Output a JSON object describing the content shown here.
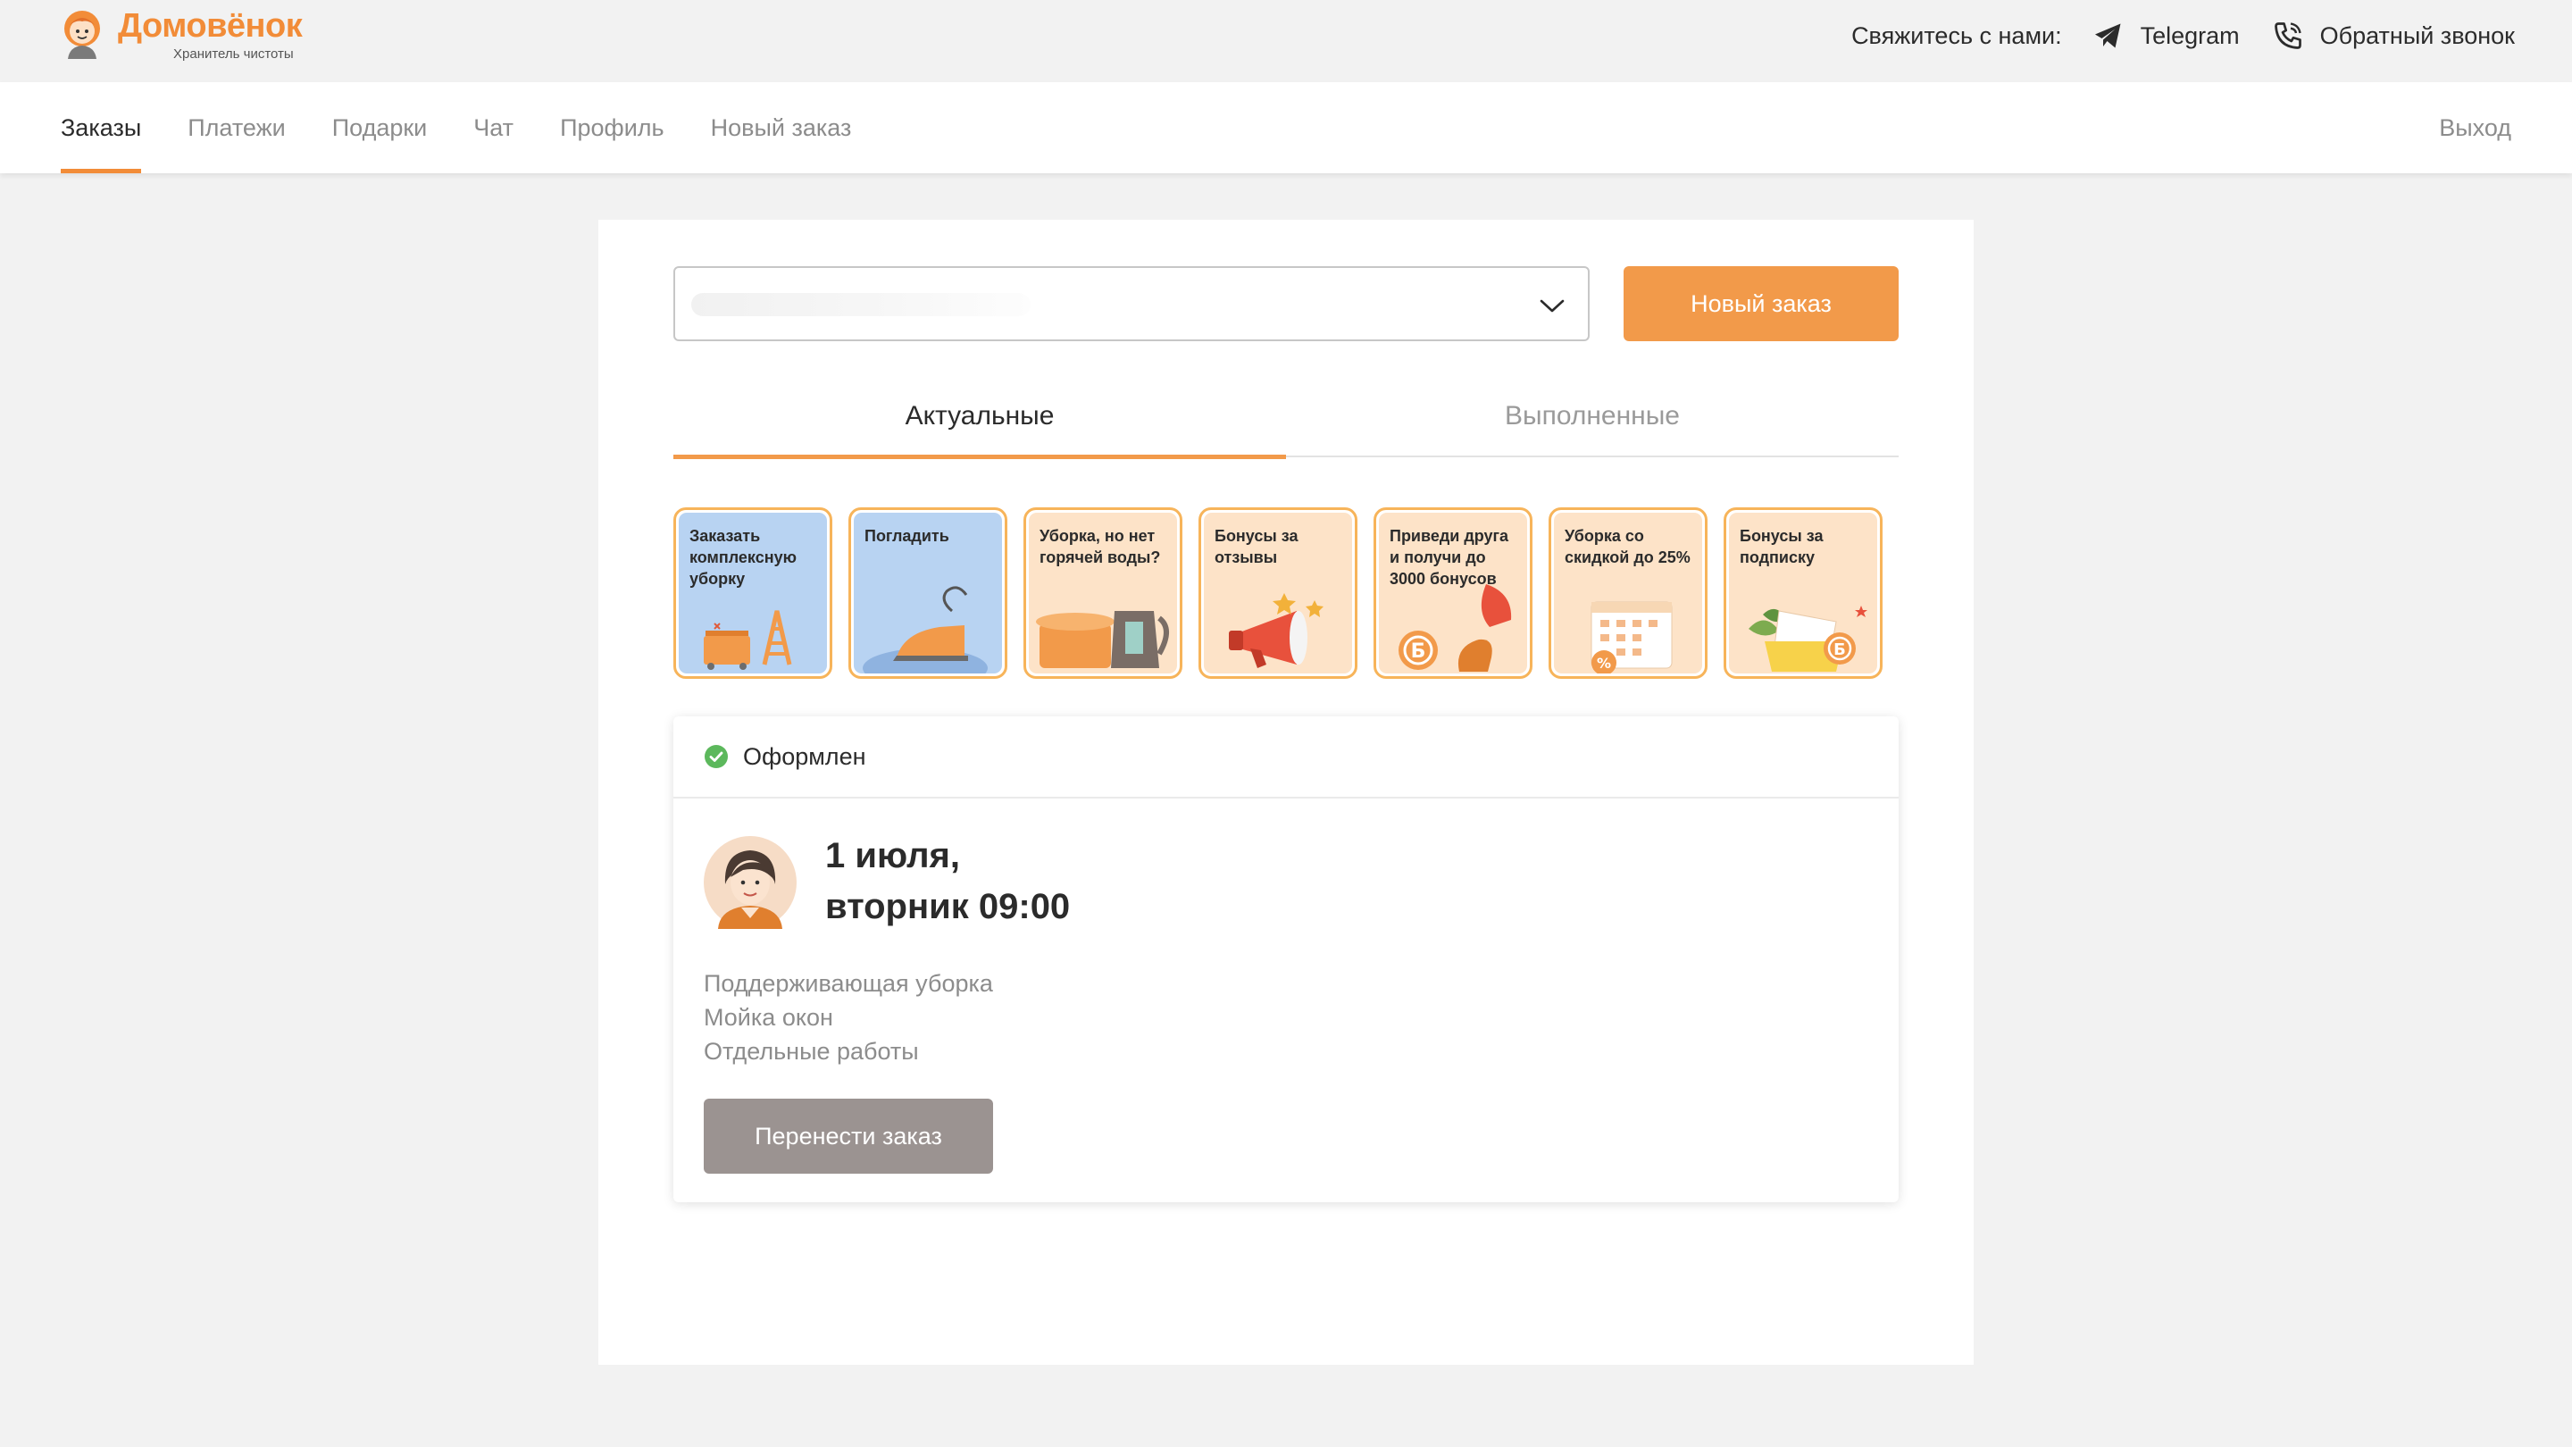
{
  "brand": {
    "name": "Домовёнок",
    "tagline": "Хранитель чистоты",
    "accent_color": "#f28c38"
  },
  "contacts": {
    "label": "Свяжитесь с нами:",
    "telegram": {
      "icon": "telegram-icon",
      "label": "Telegram"
    },
    "callback": {
      "icon": "phone-icon",
      "label": "Обратный звонок"
    }
  },
  "nav": {
    "tabs": [
      {
        "label": "Заказы",
        "active": true
      },
      {
        "label": "Платежи",
        "active": false
      },
      {
        "label": "Подарки",
        "active": false
      },
      {
        "label": "Чат",
        "active": false
      },
      {
        "label": "Профиль",
        "active": false
      },
      {
        "label": "Новый заказ",
        "active": false
      }
    ],
    "logout": "Выход"
  },
  "orders_page": {
    "address_select": {
      "value": "",
      "icon": "chevron-down-icon"
    },
    "new_order_button": "Новый заказ",
    "tabs": [
      {
        "label": "Актуальные",
        "active": true
      },
      {
        "label": "Выполненные",
        "active": false
      }
    ],
    "stories": [
      {
        "caption": "Заказать комплексную уборку",
        "bg": "#b8d3f2",
        "art": "ladder-cart"
      },
      {
        "caption": "Погладить",
        "bg": "#b8d3f2",
        "art": "iron"
      },
      {
        "caption": "Уборка, но нет горячей воды?",
        "bg": "#fde3c8",
        "art": "pot-kettle"
      },
      {
        "caption": "Бонусы за отзывы",
        "bg": "#fde3c8",
        "art": "megaphone"
      },
      {
        "caption": "Приведи друга и получи до 3000 бонусов",
        "bg": "#fde3c8",
        "art": "friend-coin"
      },
      {
        "caption": "Уборка со скидкой до 25%",
        "bg": "#fde3c8",
        "art": "calendar"
      },
      {
        "caption": "Бонусы за подписку",
        "bg": "#fde3c8",
        "art": "gift-coin"
      }
    ],
    "order": {
      "status": "Оформлен",
      "status_color": "#5cb85c",
      "date_line1": "1 июля,",
      "date_line2": "вторник 09:00",
      "services": [
        "Поддерживающая уборка",
        "Мойка окон",
        "Отдельные работы"
      ],
      "reschedule_button": "Перенести заказ"
    }
  }
}
